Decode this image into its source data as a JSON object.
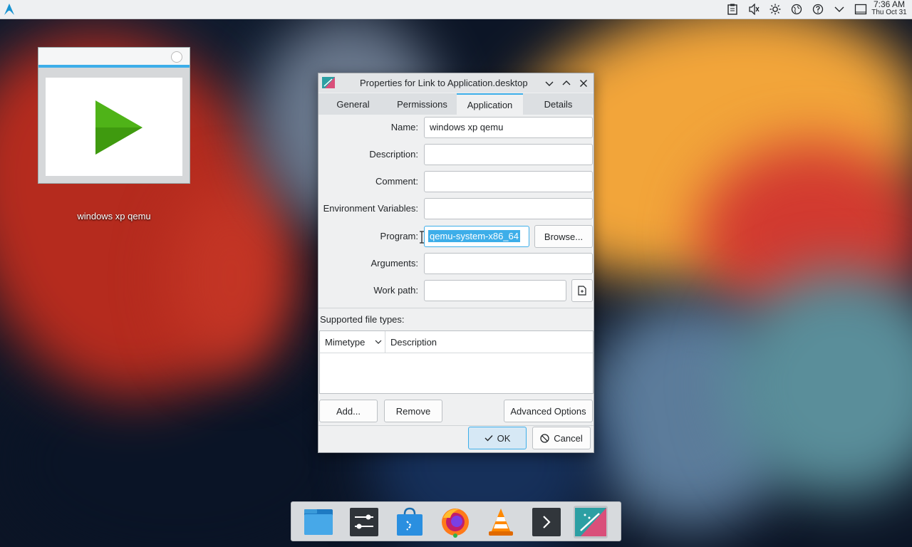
{
  "desktop": {
    "icon_label": "windows xp qemu"
  },
  "panel": {
    "clock_time": "7:36 AM",
    "clock_date": "Thu Oct 31",
    "tray_icons": [
      "clipboard-icon",
      "volume-muted-icon",
      "brightness-icon",
      "network-icon",
      "help-icon",
      "expand-icon",
      "show-desktop-icon"
    ]
  },
  "dialog": {
    "title": "Properties for Link to Application.desktop",
    "tabs": [
      {
        "label": "General"
      },
      {
        "label": "Permissions"
      },
      {
        "label": "Application"
      },
      {
        "label": "Details"
      }
    ],
    "active_tab": "Application",
    "fields": {
      "name_label": "Name:",
      "name_value": "windows xp qemu",
      "description_label": "Description:",
      "description_value": "",
      "comment_label": "Comment:",
      "comment_value": "",
      "env_label": "Environment Variables:",
      "env_value": "",
      "program_label": "Program:",
      "program_value": "qemu-system-x86_64",
      "browse_label": "Browse...",
      "arguments_label": "Arguments:",
      "arguments_value": "",
      "workpath_label": "Work path:",
      "workpath_value": ""
    },
    "filetypes": {
      "section_label": "Supported file types:",
      "col_mimetype": "Mimetype",
      "col_description": "Description",
      "rows": []
    },
    "buttons": {
      "add": "Add...",
      "remove": "Remove",
      "advanced": "Advanced Options",
      "ok": "OK",
      "cancel": "Cancel"
    }
  },
  "dock": {
    "items": [
      "file-manager-icon",
      "system-settings-icon",
      "software-store-icon",
      "firefox-icon",
      "vlc-icon",
      "terminal-icon",
      "desktop-file-editor-icon"
    ]
  },
  "colors": {
    "accent": "#3daee9",
    "panel_bg": "#eef0f2",
    "dialog_bg": "#eff0f1"
  }
}
